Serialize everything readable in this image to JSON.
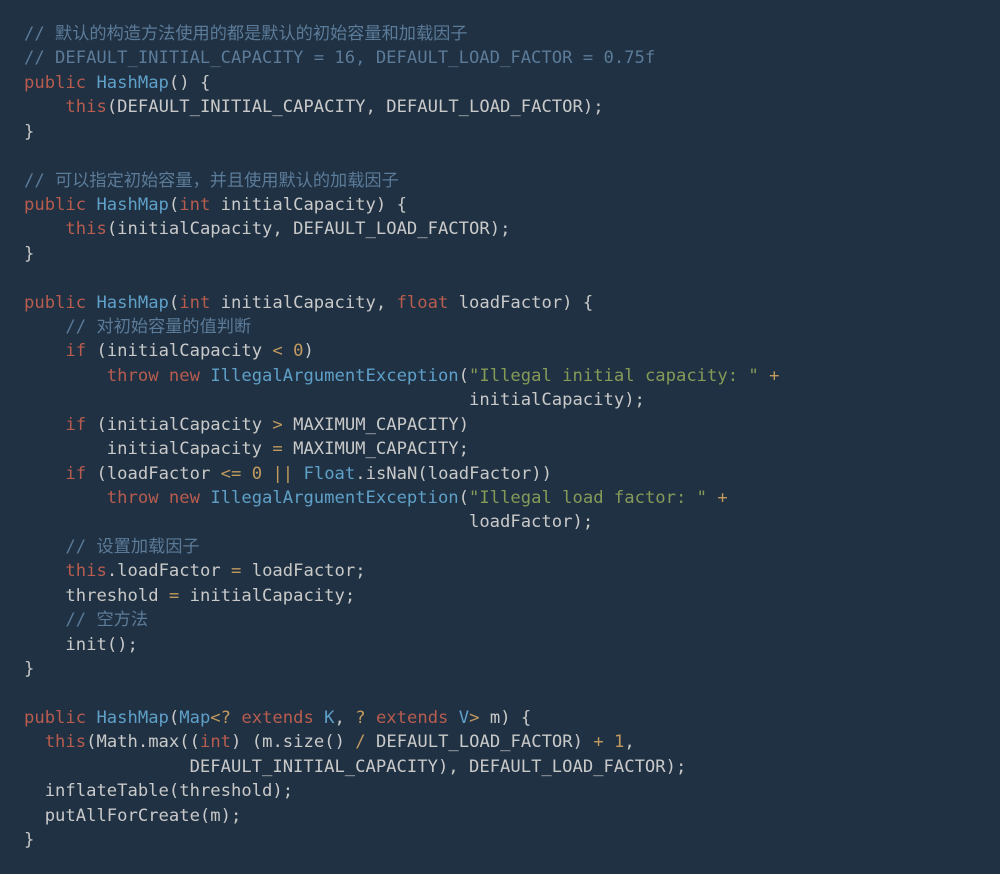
{
  "code": {
    "c1": "// 默认的构造方法使用的都是默认的初始容量和加载因子",
    "c2": "// DEFAULT_INITIAL_CAPACITY = 16, DEFAULT_LOAD_FACTOR = 0.75f",
    "kw_public": "public",
    "typ_HashMap": "HashMap",
    "pl_open_paren": "(",
    "pl_close_paren": ")",
    "pl_open_brace": "{",
    "pl_close_brace": "}",
    "pl_semi": ";",
    "pl_comma": ", ",
    "kw_this": "this",
    "id_DEFAULT_INITIAL_CAPACITY": "DEFAULT_INITIAL_CAPACITY",
    "id_DEFAULT_LOAD_FACTOR": "DEFAULT_LOAD_FACTOR",
    "c3": "// 可以指定初始容量，并且使用默认的加载因子",
    "kw_int": "int",
    "id_initialCapacity": "initialCapacity",
    "kw_float": "float",
    "id_loadFactor": "loadFactor",
    "c4": "// 对初始容量的值判断",
    "kw_if": "if",
    "op_lt": "<",
    "num_0": "0",
    "kw_throw": "throw",
    "kw_new": "new",
    "typ_IAE": "IllegalArgumentException",
    "str_illegal_capacity": "\"Illegal initial capacity: \"",
    "op_plus": "+",
    "op_gt": ">",
    "id_MAXIMUM_CAPACITY": "MAXIMUM_CAPACITY",
    "op_assign": "=",
    "op_lte": "<=",
    "op_or": "||",
    "typ_Float": "Float",
    "id_isNaN": ".isNaN",
    "str_illegal_load": "\"Illegal load factor: \"",
    "c5": "// 设置加载因子",
    "pl_dot": ".",
    "id_threshold": "threshold",
    "c6": "// 空方法",
    "id_init": "init",
    "typ_Map": "Map",
    "op_q": "?",
    "kw_extends": "extends",
    "typ_K": "K",
    "typ_V": "V",
    "id_m": "m",
    "id_Math_max": "Math.max",
    "id_m_size": "m.size",
    "op_div": "/",
    "num_1": "1",
    "id_inflateTable": "inflateTable",
    "id_putAllForCreate": "putAllForCreate"
  }
}
